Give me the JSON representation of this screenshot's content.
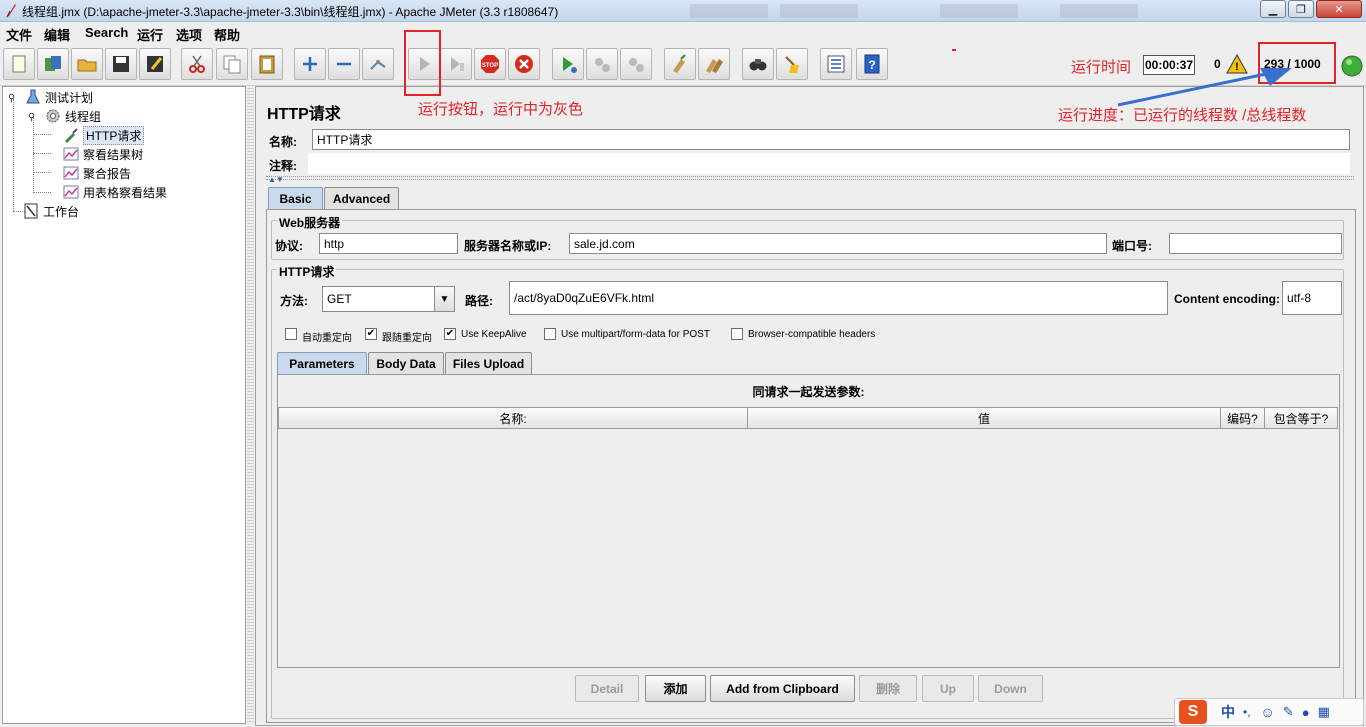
{
  "window": {
    "title": "线程组.jmx (D:\\apache-jmeter-3.3\\apache-jmeter-3.3\\bin\\线程组.jmx) - Apache JMeter (3.3 r1808647)"
  },
  "menu": [
    "文件",
    "编辑",
    "Search",
    "运行",
    "选项",
    "帮助"
  ],
  "toolbar": {
    "icons": [
      "new-icon",
      "templates-icon",
      "open-icon",
      "save-icon",
      "save-as-icon",
      "cut-icon",
      "copy-icon",
      "paste-icon",
      "expand-icon",
      "collapse-icon",
      "toggle-icon",
      "start-icon",
      "start-no-pause-icon",
      "stop-icon",
      "shutdown-icon",
      "remote-start-icon",
      "remote-stop-icon",
      "remote-shutdown-icon",
      "clear-icon",
      "clear-all-icon",
      "search-icon",
      "reset-search-icon",
      "function-helper-icon",
      "help-icon"
    ]
  },
  "status": {
    "elapsed_time": "00:00:37",
    "warning_count": "0",
    "threads": "293 / 1000"
  },
  "annotations": {
    "run_time": "运行时间",
    "run_button": "运行按钮，运行中为灰色",
    "progress": "运行进度：已运行的线程数 /总线程数"
  },
  "tree": {
    "items": [
      {
        "label": "测试计划"
      },
      {
        "label": "线程组"
      },
      {
        "label": "HTTP请求"
      },
      {
        "label": "察看结果树"
      },
      {
        "label": "聚合报告"
      },
      {
        "label": "用表格察看结果"
      },
      {
        "label": "工作台"
      }
    ]
  },
  "sampler": {
    "header": "HTTP请求",
    "name_label": "名称:",
    "name_value": "HTTP请求",
    "comment_label": "注释:",
    "comment_value": "",
    "tabs": [
      "Basic",
      "Advanced"
    ],
    "web_server_title": "Web服务器",
    "protocol_label": "协议:",
    "protocol_value": "http",
    "server_label": "服务器名称或IP:",
    "server_value": "sale.jd.com",
    "port_label": "端口号:",
    "port_value": "",
    "http_request_title": "HTTP请求",
    "method_label": "方法:",
    "method_value": "GET",
    "path_label": "路径:",
    "path_value": "/act/8yaD0qZuE6VFk.html",
    "encoding_label": "Content encoding:",
    "encoding_value": "utf-8",
    "checkboxes": [
      {
        "label": "自动重定向",
        "checked": false
      },
      {
        "label": "跟随重定向",
        "checked": true
      },
      {
        "label": "Use KeepAlive",
        "checked": true
      },
      {
        "label": "Use multipart/form-data for POST",
        "checked": false
      },
      {
        "label": "Browser-compatible headers",
        "checked": false
      }
    ],
    "param_tabs": [
      "Parameters",
      "Body Data",
      "Files Upload"
    ],
    "params_caption": "同请求一起发送参数:",
    "columns": [
      "名称:",
      "值",
      "编码?",
      "包含等于?"
    ],
    "buttons": {
      "detail": "Detail",
      "add": "添加",
      "add_clipboard": "Add from Clipboard",
      "delete": "删除",
      "up": "Up",
      "down": "Down"
    }
  },
  "ime_bar": {
    "logo": "S",
    "lang": "中"
  },
  "colors": {
    "annotation_red": "#e0242a",
    "tab_active": "#cad9ec",
    "selection": "#dce6f4"
  }
}
